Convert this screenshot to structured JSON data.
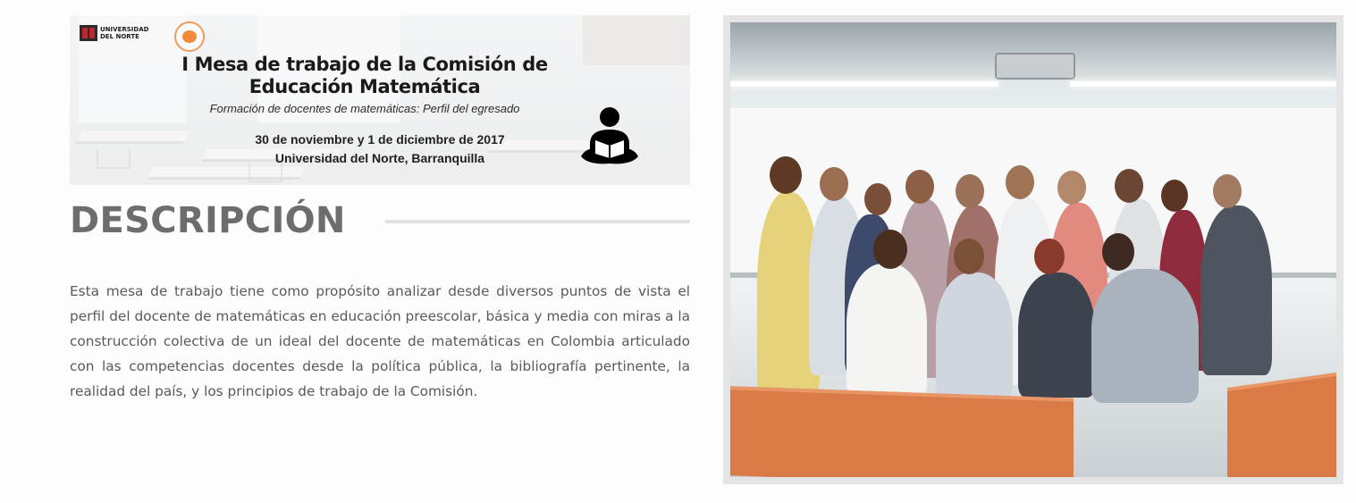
{
  "banner": {
    "logo_un_text": "UNIVERSIDAD DEL NORTE",
    "title": "I Mesa de trabajo de la Comisión de Educación Matemática",
    "subtitle": "Formación de docentes de matemáticas: Perfil del egresado",
    "date": "30 de noviembre y 1 de diciembre de 2017",
    "place": "Universidad del Norte, Barranquilla",
    "icon": "reader-icon"
  },
  "description": {
    "heading": "DESCRIPCIÓN",
    "body": "Esta mesa de trabajo tiene como propósito analizar desde diversos puntos de vista el perfil del docente de matemáticas en educación preescolar, básica y media con miras a la construcción colectiva de un ideal del docente de matemáticas en Colombia articulado con las competencias docentes desde la política pública, la bibliografía pertinente, la realidad del país, y los principios de trabajo de la Comisión."
  },
  "colors": {
    "heading": "#6d6d6d",
    "body_text": "#5a5a5a",
    "frame": "#e4e4e4",
    "accent_orange": "#f28a3a",
    "brand_red": "#c0262d"
  }
}
